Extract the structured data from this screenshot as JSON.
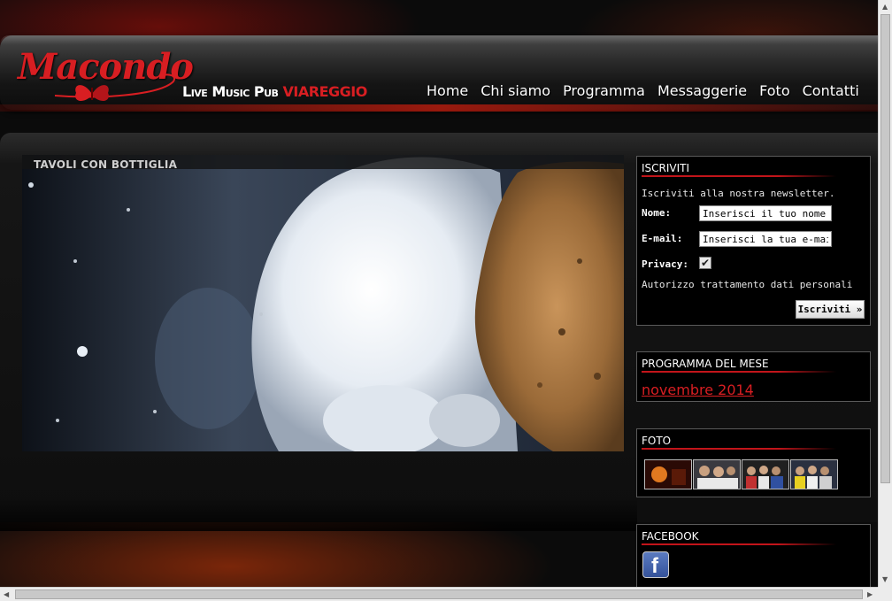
{
  "brand": {
    "logo": "Macondo",
    "tagline_main": "Live Music Pub",
    "tagline_city": "VIAREGGIO",
    "accent_color": "#d81e22"
  },
  "nav": {
    "items": [
      "Home",
      "Chi siamo",
      "Programma",
      "Messaggerie",
      "Foto",
      "Contatti"
    ]
  },
  "hero": {
    "caption": "TAVOLI CON BOTTIGLIA"
  },
  "newsletter": {
    "title": "ISCRIVITI",
    "intro": "Iscriviti alla nostra newsletter.",
    "name_label": "Nome:",
    "name_value": "Inserisci il tuo nome",
    "email_label": "E-mail:",
    "email_value": "Inserisci la tua e-mail",
    "privacy_label": "Privacy:",
    "privacy_checked": true,
    "consent_text": "Autorizzo trattamento dati personali",
    "submit_label": "Iscriviti »"
  },
  "programma": {
    "title": "PROGRAMMA DEL MESE",
    "month_link": "novembre 2014"
  },
  "foto": {
    "title": "FOTO",
    "thumbnails": [
      "photo-thumb",
      "photo-thumb",
      "photo-thumb",
      "photo-thumb"
    ]
  },
  "facebook": {
    "title": "FACEBOOK",
    "icon": "facebook-icon"
  }
}
